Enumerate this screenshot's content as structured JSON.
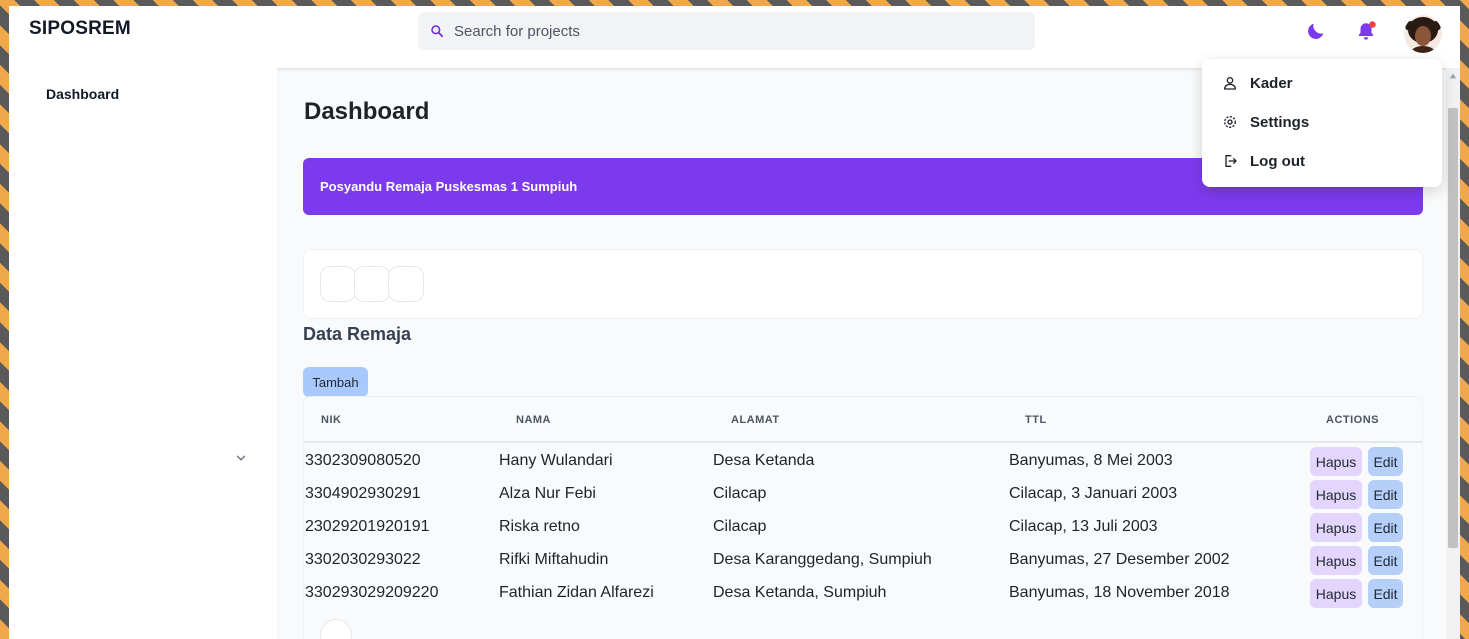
{
  "app": {
    "title": "SIPOSREM",
    "search": {
      "placeholder": "Search for projects",
      "value": ""
    },
    "icons": {
      "search": "search-icon",
      "theme": "moon-icon",
      "notifications": "bell-icon",
      "avatar": "avatar"
    },
    "colors": {
      "accent": "#7c3aed",
      "notification_dot": "#ef4444",
      "button_blue": "#a9c8fb",
      "button_purple": "#e3d5fb"
    }
  },
  "sidebar": {
    "items": [
      {
        "label": "Dashboard"
      }
    ]
  },
  "user_menu": {
    "items": [
      {
        "label": "Kader",
        "icon": "user-icon"
      },
      {
        "label": "Settings",
        "icon": "gear-icon"
      },
      {
        "label": "Log out",
        "icon": "logout-icon"
      }
    ]
  },
  "main": {
    "title": "Dashboard",
    "banner": "Posyandu Remaja Puskesmas 1 Sumpiuh",
    "section_title": "Data Remaja",
    "add_button": "Tambah",
    "table": {
      "headers": {
        "nik": "NIK",
        "nama": "NAMA",
        "alamat": "ALAMAT",
        "ttl": "TTL",
        "actions": "ACTIONS"
      },
      "rows": [
        {
          "nik": "3302309080520",
          "nama": "Hany Wulandari",
          "alamat": "Desa Ketanda",
          "ttl": "Banyumas, 8 Mei 2003"
        },
        {
          "nik": "3304902930291",
          "nama": "Alza Nur Febi",
          "alamat": "Cilacap",
          "ttl": "Cilacap, 3 Januari 2003"
        },
        {
          "nik": "23029201920191",
          "nama": "Riska retno",
          "alamat": "Cilacap",
          "ttl": "Cilacap, 13 Juli 2003"
        },
        {
          "nik": "3302030293022",
          "nama": "Rifki Miftahudin",
          "alamat": "Desa Karanggedang, Sumpiuh",
          "ttl": "Banyumas, 27 Desember 2002"
        },
        {
          "nik": "330293029209220",
          "nama": "Fathian Zidan Alfarezi",
          "alamat": "Desa Ketanda, Sumpiuh",
          "ttl": "Banyumas, 18 November 2018"
        }
      ],
      "actions": {
        "delete_label": "Hapus",
        "edit_label": "Edit"
      }
    }
  }
}
